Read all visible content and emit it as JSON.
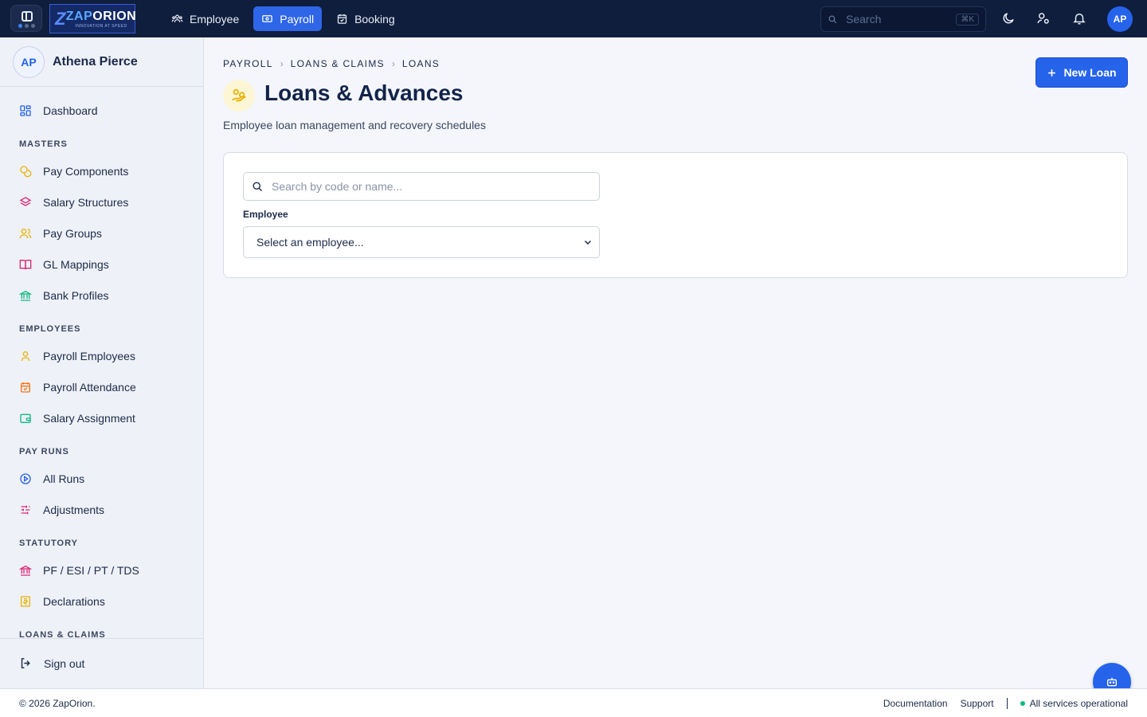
{
  "brand": {
    "logo_word_1": "ZAP",
    "logo_word_2": "ORION",
    "logo_tagline": "INNOVATION AT SPEED"
  },
  "topnav": [
    {
      "label": "Employee",
      "icon": "users-icon",
      "active": false
    },
    {
      "label": "Payroll",
      "icon": "banknote-icon",
      "active": true
    },
    {
      "label": "Booking",
      "icon": "calendar-check-icon",
      "active": false
    }
  ],
  "search": {
    "placeholder": "Search",
    "shortcut": "⌘K"
  },
  "user": {
    "initials": "AP",
    "name": "Athena Pierce"
  },
  "sidebar": {
    "dashboard": "Dashboard",
    "sections": {
      "masters": "MASTERS",
      "employees": "EMPLOYEES",
      "pay_runs": "PAY RUNS",
      "statutory": "STATUTORY",
      "loans_claims": "LOANS & CLAIMS"
    },
    "items": {
      "pay_components": "Pay Components",
      "salary_structures": "Salary Structures",
      "pay_groups": "Pay Groups",
      "gl_mappings": "GL Mappings",
      "bank_profiles": "Bank Profiles",
      "payroll_employees": "Payroll Employees",
      "payroll_attendance": "Payroll Attendance",
      "salary_assignment": "Salary Assignment",
      "all_runs": "All Runs",
      "adjustments": "Adjustments",
      "statutory_codes": "PF / ESI / PT / TDS",
      "declarations": "Declarations"
    },
    "sign_out": "Sign out"
  },
  "breadcrumb": [
    "PAYROLL",
    "LOANS & CLAIMS",
    "LOANS"
  ],
  "page": {
    "title": "Loans & Advances",
    "subtitle": "Employee loan management and recovery schedules",
    "new_button": "New Loan"
  },
  "filters": {
    "search_placeholder": "Search by code or name...",
    "employee_label": "Employee",
    "employee_selected": "Select an employee..."
  },
  "footer": {
    "copyright": "© 2026 ZapOrion.",
    "documentation": "Documentation",
    "support": "Support",
    "status": "All services operational"
  },
  "colors": {
    "navbar": "#0f1e3d",
    "accent": "#2563eb",
    "status_ok": "#10b981"
  }
}
